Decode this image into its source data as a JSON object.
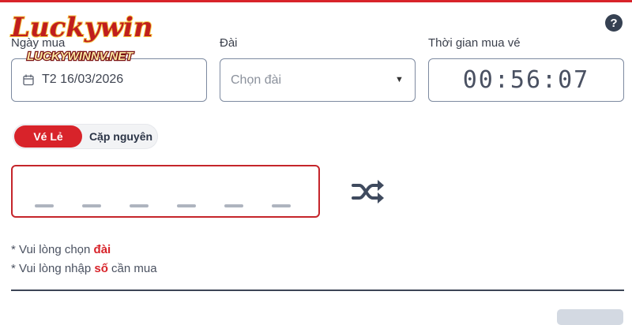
{
  "brand": {
    "logo_text": "Luckywin",
    "logo_domain": "LUCKYWINNV.NET"
  },
  "help": {
    "label": "?"
  },
  "date": {
    "label": "Ngày mua",
    "value": "T2 16/03/2026",
    "icon": "calendar-icon"
  },
  "station": {
    "label": "Đài",
    "placeholder": "Chọn đài",
    "icon": "caret-down-icon"
  },
  "timer": {
    "label": "Thời gian mua vé",
    "value": "00:56:07"
  },
  "tabs": [
    {
      "label": "Vé Lẻ",
      "active": true
    },
    {
      "label": "Cặp nguyên",
      "active": false
    }
  ],
  "number_input": {
    "slots": 6
  },
  "shuffle": {
    "icon": "shuffle-icon"
  },
  "messages": [
    {
      "prefix": "* Vui lòng chọn ",
      "highlight": "đài",
      "suffix": ""
    },
    {
      "prefix": "* Vui lòng nhập ",
      "highlight": "số",
      "suffix": " cần mua"
    }
  ],
  "colors": {
    "accent": "#d8232a",
    "border": "#7d8aa0",
    "text": "#2b3446"
  }
}
